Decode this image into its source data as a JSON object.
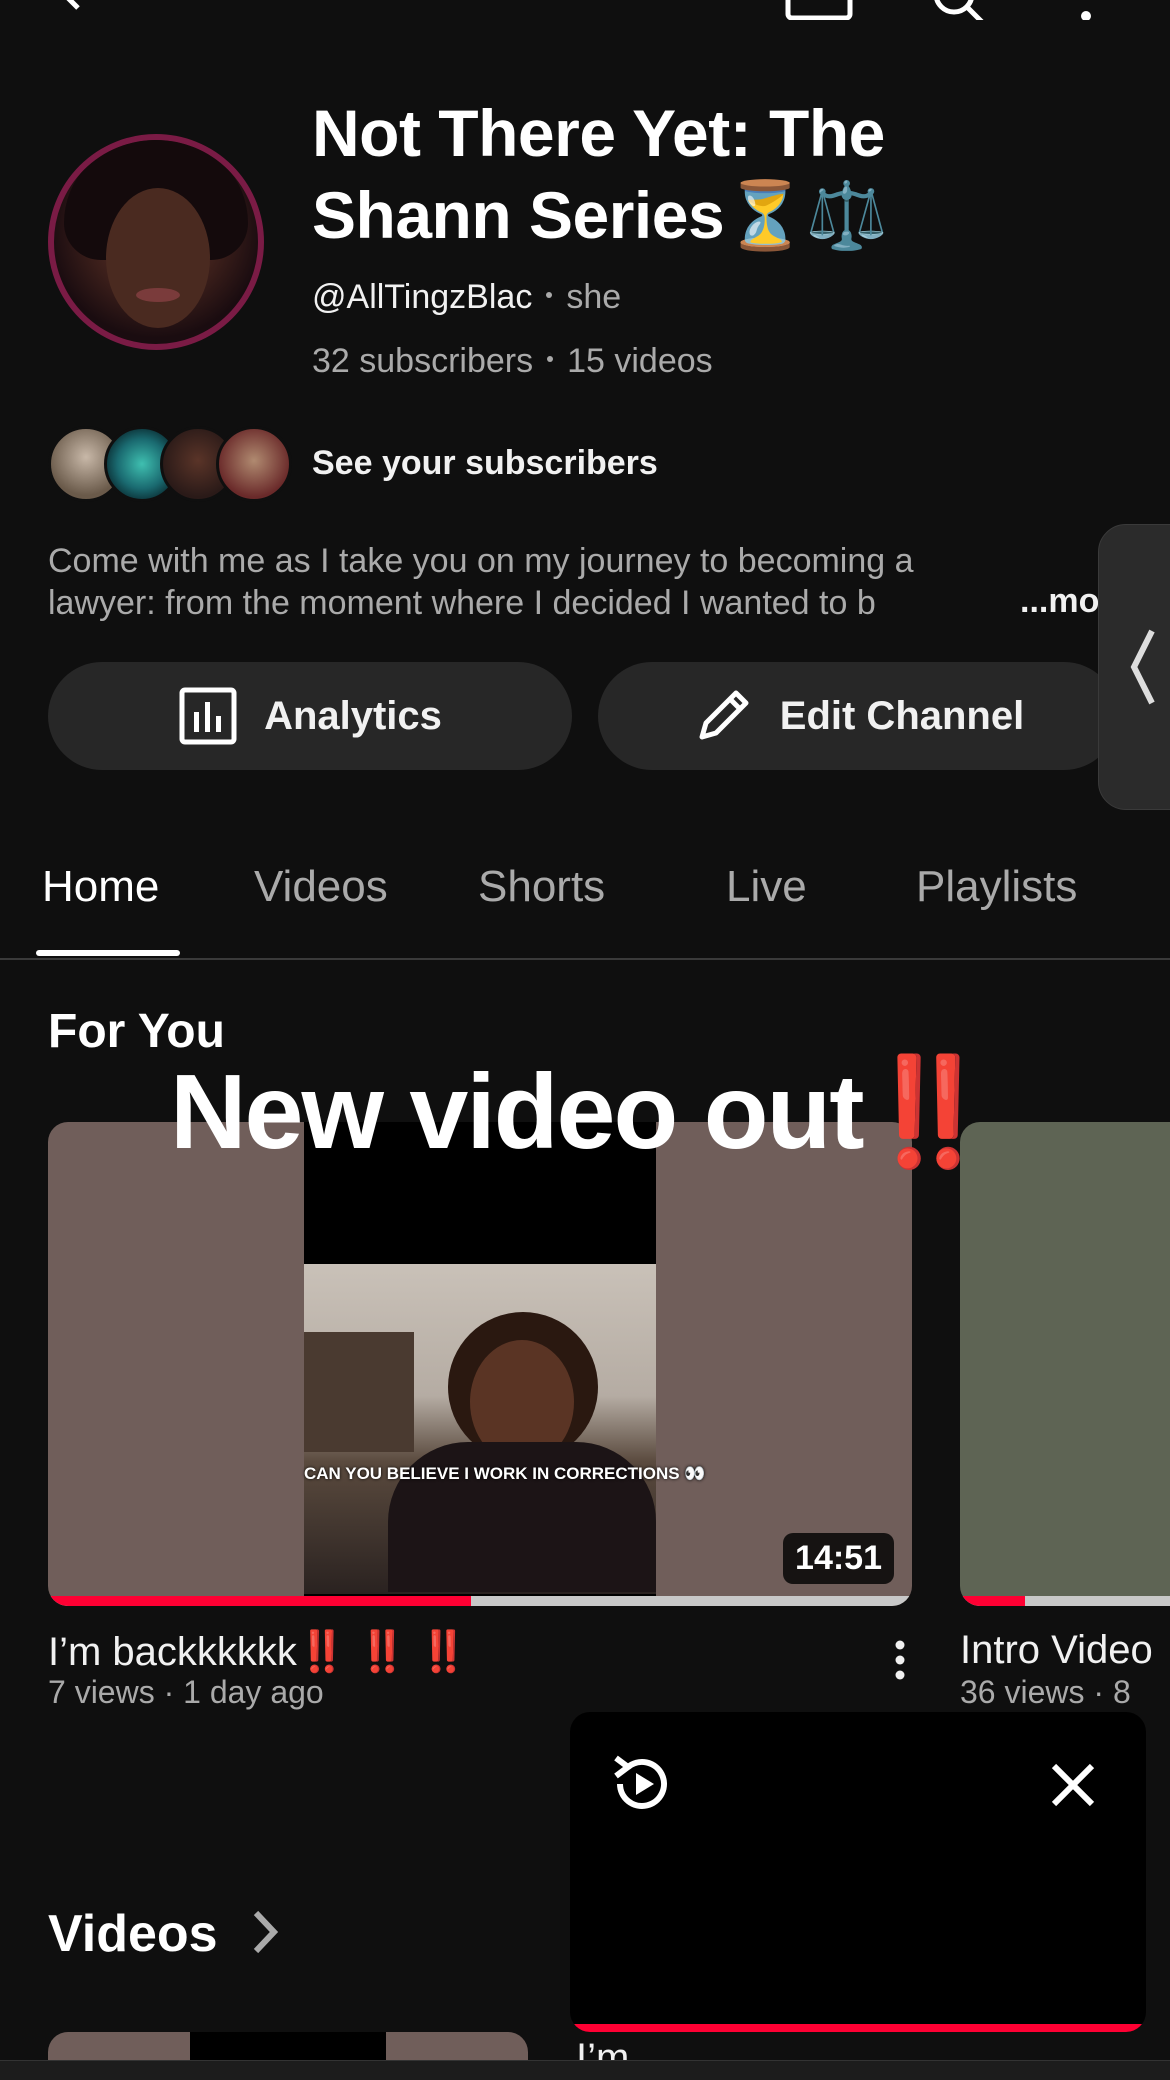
{
  "channel": {
    "title": "Not There Yet: The Shann Series⏳⚖️",
    "handle": "@AllTingzBlac",
    "pronouns": "she",
    "subscribers": "32 subscribers",
    "videos_count": "15 videos",
    "see_subscribers": "See your subscribers",
    "description_line1": "Come with me as I take you on my journey to becoming a",
    "description_line2": "lawyer: from the moment where I decided I wanted to b",
    "more_label": "...more"
  },
  "buttons": {
    "analytics": "Analytics",
    "edit_channel": "Edit Channel"
  },
  "tabs": [
    {
      "label": "Home",
      "active": true
    },
    {
      "label": "Videos",
      "active": false
    },
    {
      "label": "Shorts",
      "active": false
    },
    {
      "label": "Live",
      "active": false
    },
    {
      "label": "Playlists",
      "active": false
    }
  ],
  "for_you": {
    "section_title": "For You",
    "overlay_text": "New video out",
    "overlay_emoji": "‼️",
    "videos": [
      {
        "title": "I’m backkkkkk",
        "title_emoji": "‼️ ‼️ ‼️",
        "meta": "7 views · 1 day ago",
        "duration": "14:51",
        "thumbnail_caption": "CAN YOU BELIEVE I WORK IN CORRECTIONS 👀",
        "watched_fraction": 0.49
      },
      {
        "title": "Intro Video",
        "meta": "36 views · 8",
        "watched_fraction": 0.25
      }
    ]
  },
  "videos_section": {
    "title": "Videos",
    "first_title": "I’m"
  },
  "colors": {
    "background": "#0f0f0f",
    "button": "#272727",
    "accent_red": "#ff0033",
    "secondary_text": "#aaaaaa"
  },
  "icons": [
    "back-icon",
    "cast-icon",
    "search-icon",
    "more-vert-icon",
    "analytics-icon",
    "pencil-icon",
    "chevron-left-icon",
    "chevron-right-icon",
    "replay-icon",
    "close-icon",
    "kebab-icon"
  ]
}
